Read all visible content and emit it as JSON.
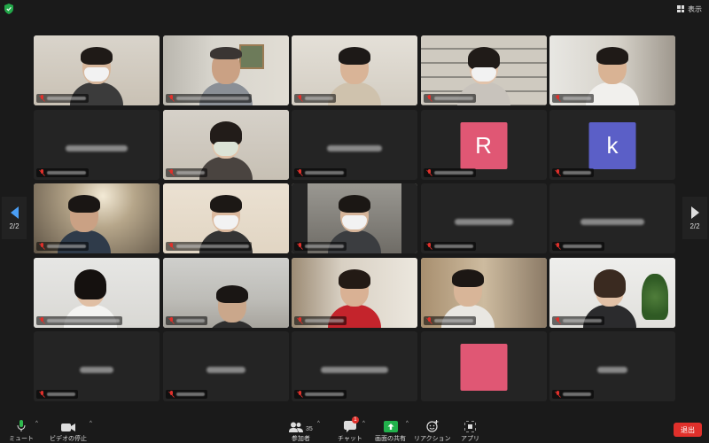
{
  "topbar": {
    "view_label": "表示"
  },
  "pager": {
    "left_label": "2/2",
    "right_label": "2/2"
  },
  "colors": {
    "avatar_r": "#e05774",
    "avatar_k": "#5b5fc7",
    "avatar_blank": "#e05774",
    "leave": "#e0302b",
    "share": "#22b14c",
    "nav_arrow": "#4a9ef5"
  },
  "tiles": [
    {
      "type": "video",
      "row": 1,
      "col": 1
    },
    {
      "type": "video",
      "row": 1,
      "col": 2
    },
    {
      "type": "video",
      "row": 1,
      "col": 3
    },
    {
      "type": "video",
      "row": 1,
      "col": 4
    },
    {
      "type": "video",
      "row": 1,
      "col": 5
    },
    {
      "type": "name",
      "row": 2,
      "col": 1
    },
    {
      "type": "video",
      "row": 2,
      "col": 2
    },
    {
      "type": "name",
      "row": 2,
      "col": 3
    },
    {
      "type": "avatar",
      "row": 2,
      "col": 4,
      "letter": "R"
    },
    {
      "type": "avatar",
      "row": 2,
      "col": 5,
      "letter": "k"
    },
    {
      "type": "video",
      "row": 3,
      "col": 1
    },
    {
      "type": "video",
      "row": 3,
      "col": 2
    },
    {
      "type": "video",
      "row": 3,
      "col": 3
    },
    {
      "type": "name",
      "row": 3,
      "col": 4
    },
    {
      "type": "name",
      "row": 3,
      "col": 5
    },
    {
      "type": "video",
      "row": 4,
      "col": 1
    },
    {
      "type": "video",
      "row": 4,
      "col": 2
    },
    {
      "type": "video",
      "row": 4,
      "col": 3
    },
    {
      "type": "video",
      "row": 4,
      "col": 4
    },
    {
      "type": "video",
      "row": 4,
      "col": 5
    },
    {
      "type": "name",
      "row": 5,
      "col": 1
    },
    {
      "type": "name",
      "row": 5,
      "col": 2
    },
    {
      "type": "name",
      "row": 5,
      "col": 3
    },
    {
      "type": "avatar",
      "row": 5,
      "col": 4,
      "letter": ""
    },
    {
      "type": "name",
      "row": 5,
      "col": 5
    }
  ],
  "toolbar": {
    "mute_label": "ミュート",
    "video_label": "ビデオの停止",
    "participants_label": "参加者",
    "participants_count": "35",
    "chat_label": "チャット",
    "chat_badge": "1",
    "share_label": "画面の共有",
    "reaction_label": "リアクション",
    "apps_label": "アプリ",
    "leave_label": "退出"
  }
}
